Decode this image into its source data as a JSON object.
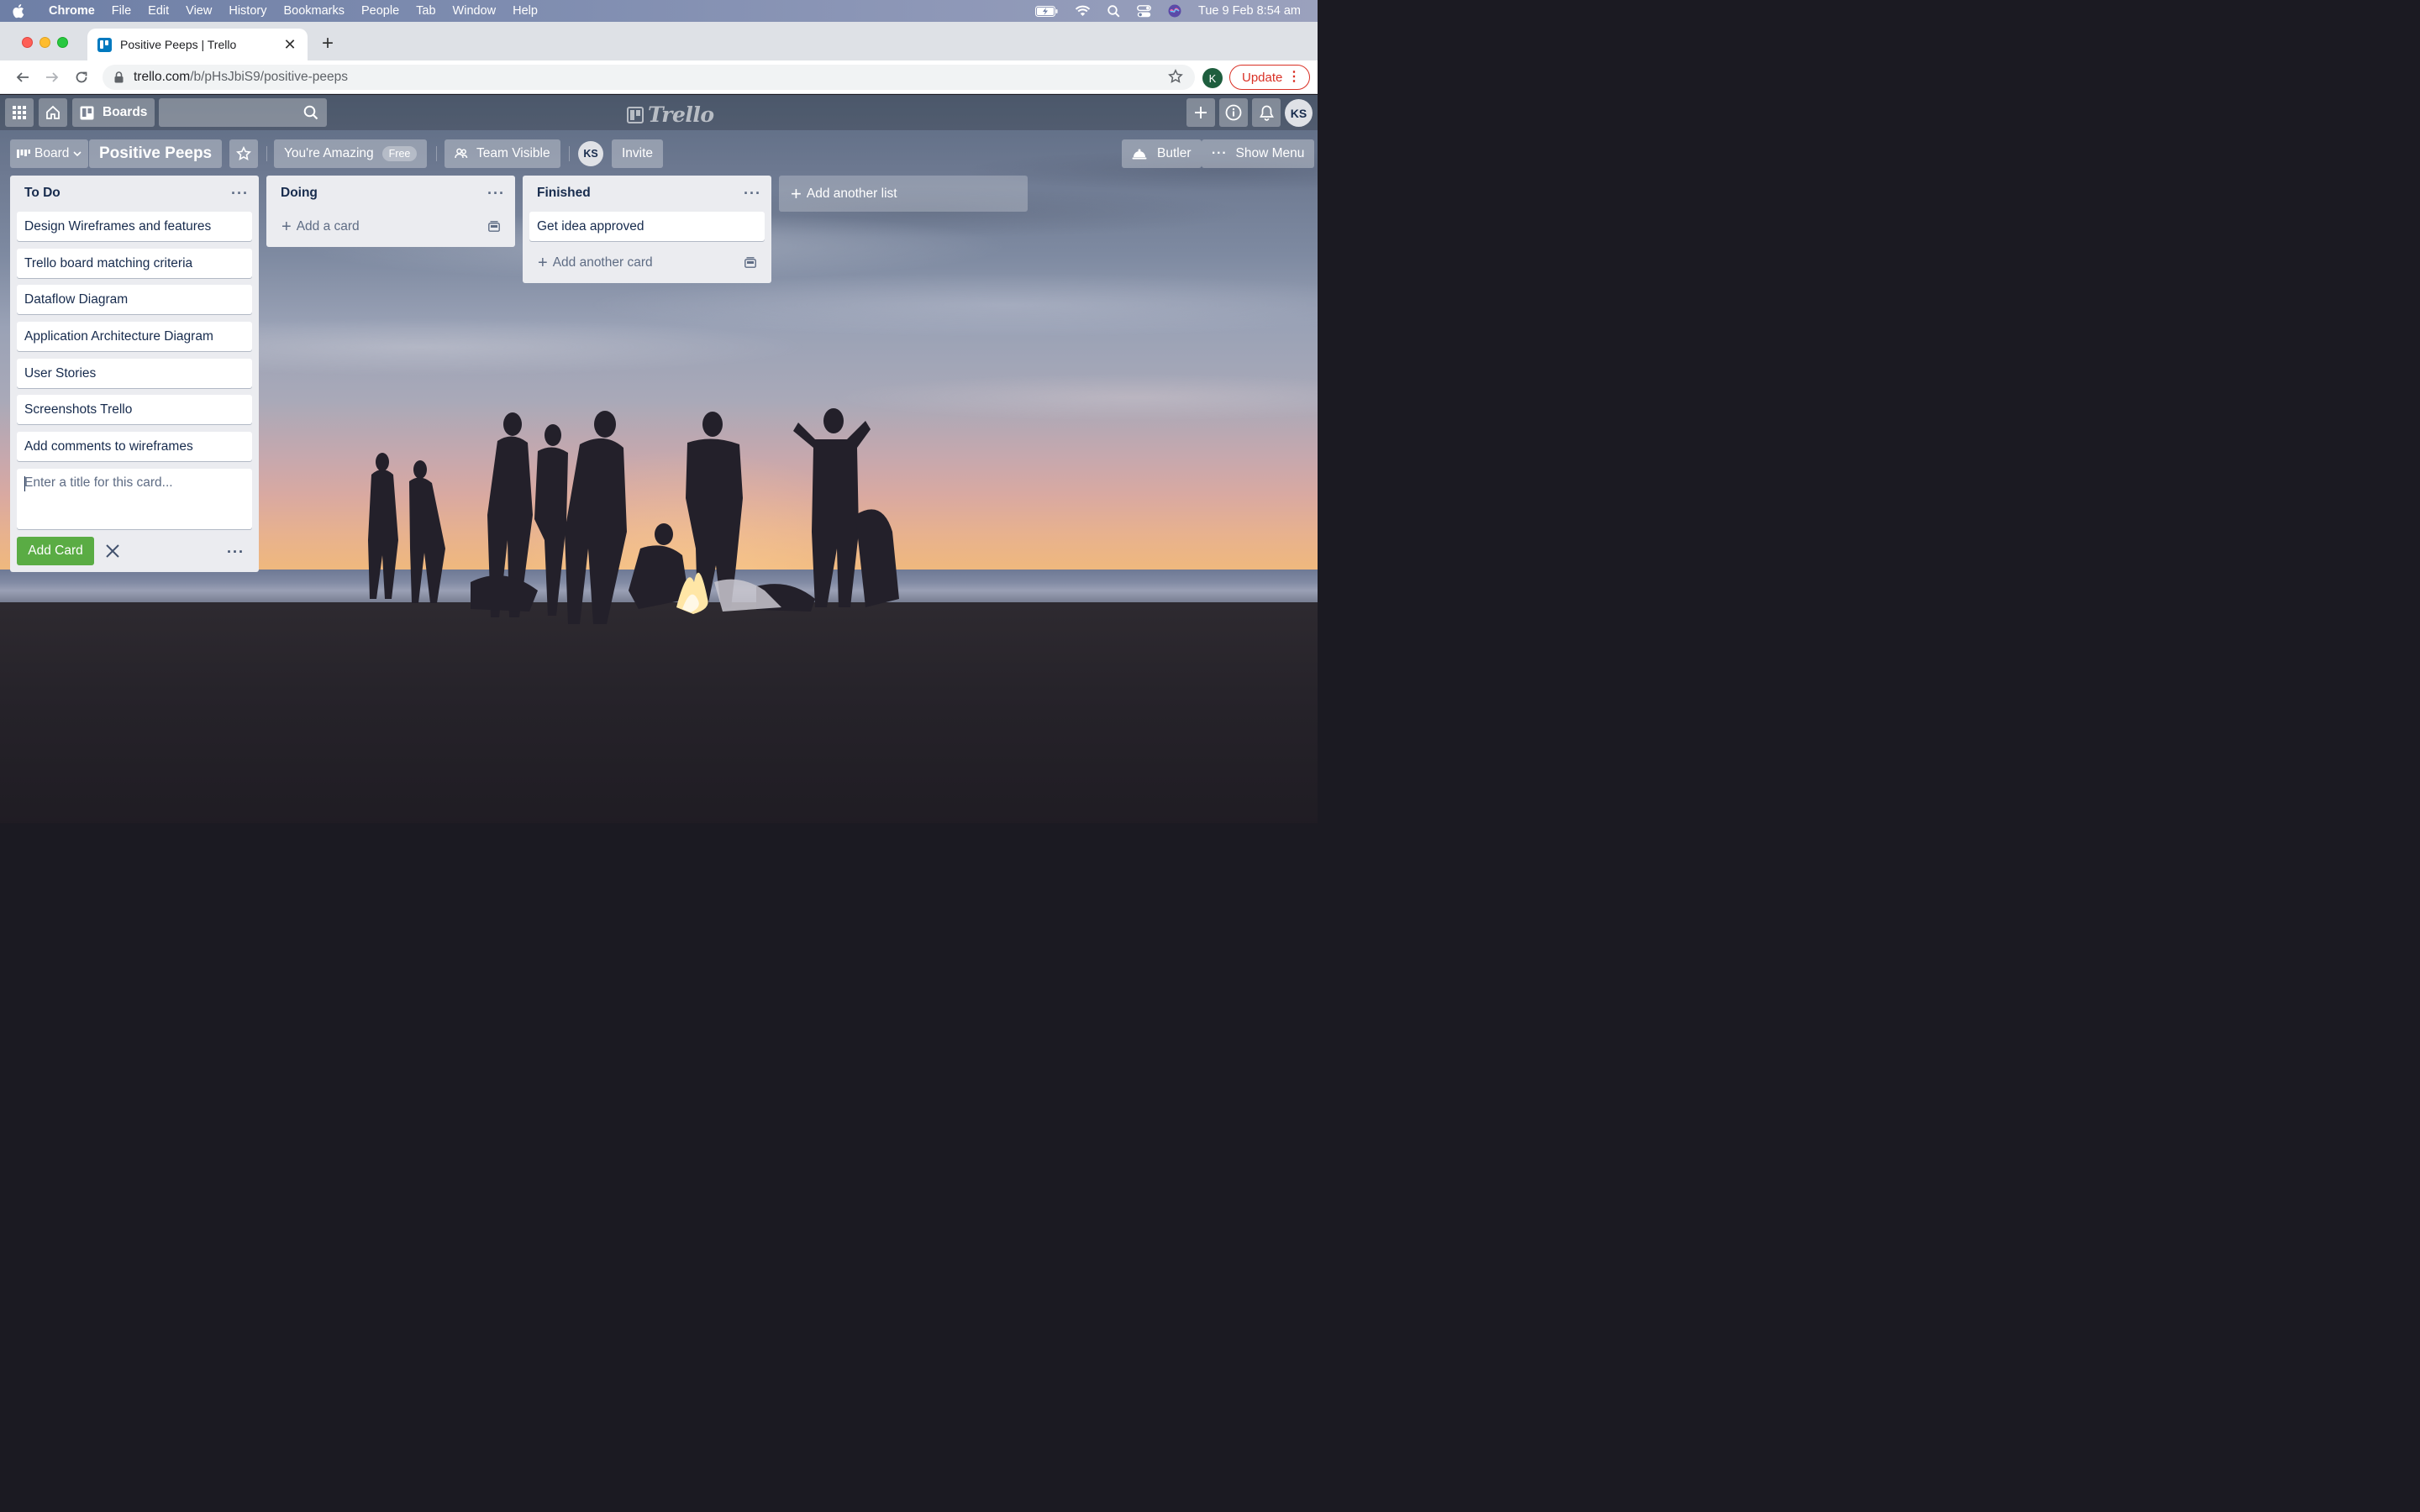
{
  "menubar": {
    "app_name": "Chrome",
    "items": [
      "File",
      "Edit",
      "View",
      "History",
      "Bookmarks",
      "People",
      "Tab",
      "Window",
      "Help"
    ],
    "datetime": "Tue 9 Feb  8:54 am",
    "icons": [
      "battery-charging-icon",
      "wifi-icon",
      "spotlight-search-icon",
      "control-center-icon",
      "siri-icon"
    ]
  },
  "browser": {
    "tab_title": "Positive Peeps | Trello",
    "url_host": "trello.com",
    "url_path": "/b/pHsJbiS9/positive-peeps",
    "profile_initial": "K",
    "update_label": "Update"
  },
  "trello_header": {
    "boards_label": "Boards",
    "logo_text": "Trello",
    "avatar_initials": "KS"
  },
  "board": {
    "view_label": "Board",
    "title": "Positive Peeps",
    "team_name": "You're Amazing",
    "plan_badge": "Free",
    "visibility": "Team Visible",
    "member_initials": "KS",
    "invite_label": "Invite",
    "butler_label": "Butler",
    "show_menu_label": "Show Menu"
  },
  "lists": [
    {
      "title": "To Do",
      "cards": [
        "Design Wireframes and features",
        "Trello board matching criteria",
        "Dataflow Diagram",
        "Application Architecture Diagram",
        "User Stories",
        "Screenshots Trello",
        "Add comments to wireframes"
      ],
      "composer_placeholder": "Enter a title for this card...",
      "add_button_label": "Add Card"
    },
    {
      "title": "Doing",
      "cards": [],
      "add_card_label": "Add a card"
    },
    {
      "title": "Finished",
      "cards": [
        "Get idea approved"
      ],
      "add_card_label": "Add another card"
    }
  ],
  "add_list_label": "Add another list",
  "colors": {
    "composer_button": "#5aac44",
    "list_bg": "#ebecf0",
    "update_red": "#d93025"
  }
}
